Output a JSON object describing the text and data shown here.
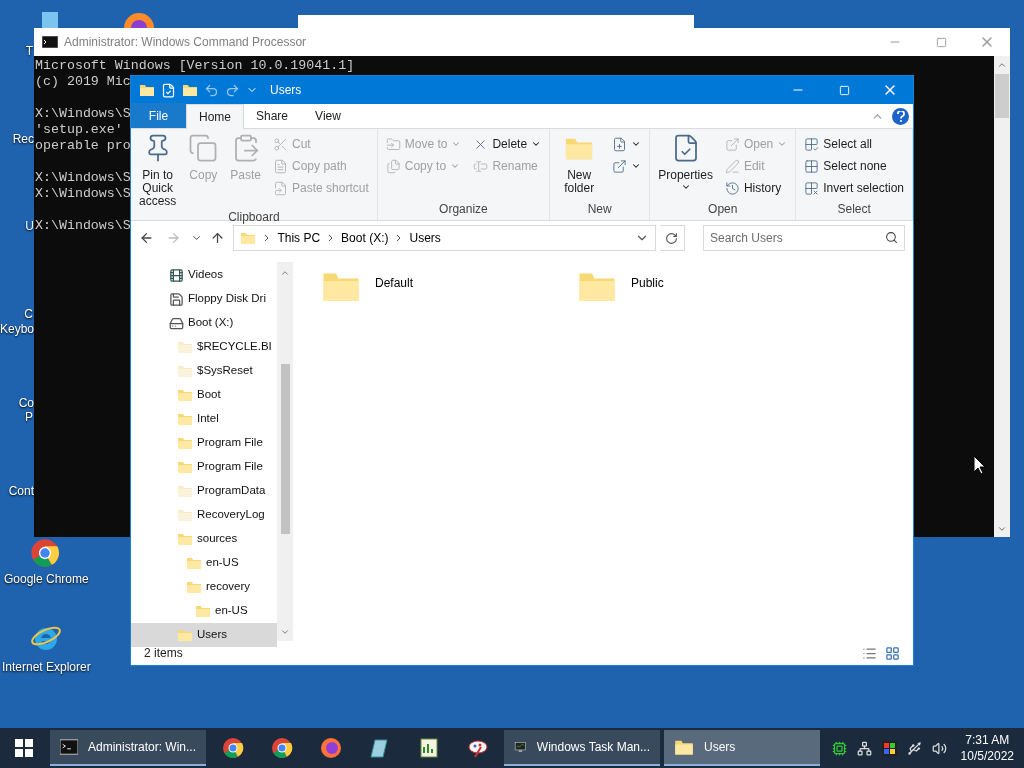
{
  "desktop": {
    "icons": [
      {
        "label": "T"
      },
      {
        "label": "Rec"
      },
      {
        "label": "U"
      },
      {
        "label": "C"
      },
      {
        "label": "Keybo"
      },
      {
        "label": "Co"
      },
      {
        "label": "P"
      },
      {
        "label": "Cont"
      },
      {
        "label": "Google Chrome"
      },
      {
        "label": "Internet Explorer"
      }
    ]
  },
  "console_window": {
    "title": "Administrator: Windows Command Processor",
    "blocks": [
      [
        "Microsoft Windows [Version 10.0.19041.1]",
        "(c) 2019 Mic"
      ],
      [
        "X:\\Windows\\S",
        "'setup.exe'",
        "operable pro"
      ],
      [
        "X:\\Windows\\S",
        "X:\\Windows\\S"
      ],
      [
        "X:\\Windows\\S"
      ]
    ]
  },
  "explorer": {
    "title": "Users",
    "tabs": [
      {
        "label": "File",
        "kind": "file"
      },
      {
        "label": "Home",
        "kind": "tab",
        "selected": true
      },
      {
        "label": "Share",
        "kind": "tab",
        "selected": false
      },
      {
        "label": "View",
        "kind": "tab",
        "selected": false
      }
    ],
    "ribbon": [
      {
        "label": "Clipboard",
        "columns": [
          {
            "kind": "large",
            "items": [
              {
                "label": "Pin to Quick access",
                "disabled": false,
                "dropdown": false
              }
            ]
          },
          {
            "kind": "large",
            "items": [
              {
                "label": "Copy",
                "disabled": true,
                "dropdown": false
              }
            ]
          },
          {
            "kind": "large",
            "items": [
              {
                "label": "Paste",
                "disabled": true,
                "dropdown": false
              }
            ]
          },
          {
            "kind": "stack",
            "items": [
              {
                "label": "Cut",
                "disabled": true,
                "dropdown": false
              },
              {
                "label": "Copy path",
                "disabled": true,
                "dropdown": false
              },
              {
                "label": "Paste shortcut",
                "disabled": true,
                "dropdown": false
              }
            ]
          }
        ]
      },
      {
        "label": "Organize",
        "columns": [
          {
            "kind": "stack",
            "items": [
              {
                "label": "Move to",
                "disabled": true,
                "dropdown": true
              },
              {
                "label": "Copy to",
                "disabled": true,
                "dropdown": true
              }
            ]
          },
          {
            "kind": "stack",
            "items": [
              {
                "label": "Delete",
                "disabled": false,
                "dropdown": true
              },
              {
                "label": "Rename",
                "disabled": true,
                "dropdown": false
              }
            ]
          }
        ]
      },
      {
        "label": "New",
        "columns": [
          {
            "kind": "large",
            "items": [
              {
                "label": "New folder",
                "disabled": false,
                "dropdown": false
              }
            ]
          },
          {
            "kind": "stack",
            "items": [
              {
                "disabled": false,
                "dropdown": true
              },
              {
                "disabled": false,
                "dropdown": true
              }
            ]
          }
        ]
      },
      {
        "label": "Open",
        "columns": [
          {
            "kind": "large",
            "items": [
              {
                "label": "Properties",
                "disabled": false,
                "dropdown": true
              }
            ]
          },
          {
            "kind": "stack",
            "items": [
              {
                "label": "Open",
                "disabled": true,
                "dropdown": true
              },
              {
                "label": "Edit",
                "disabled": true,
                "dropdown": false
              },
              {
                "label": "History",
                "disabled": false,
                "dropdown": false
              }
            ]
          }
        ]
      },
      {
        "label": "Select",
        "columns": [
          {
            "kind": "stack",
            "items": [
              {
                "label": "Select all",
                "disabled": false,
                "dropdown": false
              },
              {
                "label": "Select none",
                "disabled": false,
                "dropdown": false
              },
              {
                "label": "Invert selection",
                "disabled": false,
                "dropdown": false
              }
            ]
          }
        ]
      }
    ],
    "breadcrumbs": [
      "This PC",
      "Boot (X:)",
      "Users"
    ],
    "search": {
      "placeholder": "Search Users"
    },
    "nav_tree": [
      {
        "label": "Videos",
        "kind": "videos",
        "selected": false
      },
      {
        "label": "Floppy Disk Dri",
        "kind": "floppy",
        "selected": false
      },
      {
        "label": "Boot (X:)",
        "kind": "drive",
        "selected": false,
        "children": [
          {
            "label": "$RECYCLE.BI",
            "kind": "folder",
            "hidden": true,
            "selected": false
          },
          {
            "label": "$SysReset",
            "kind": "folder",
            "hidden": true,
            "selected": false
          },
          {
            "label": "Boot",
            "kind": "folder",
            "hidden": false,
            "selected": false
          },
          {
            "label": "Intel",
            "kind": "folder",
            "hidden": false,
            "selected": false
          },
          {
            "label": "Program File",
            "kind": "folder",
            "hidden": false,
            "selected": false
          },
          {
            "label": "Program File",
            "kind": "folder",
            "hidden": false,
            "selected": false
          },
          {
            "label": "ProgramData",
            "kind": "folder",
            "hidden": true,
            "selected": false
          },
          {
            "label": "RecoveryLog",
            "kind": "folder",
            "hidden": true,
            "selected": false
          },
          {
            "label": "sources",
            "kind": "folder",
            "hidden": false,
            "selected": false,
            "children": [
              {
                "label": "en-US",
                "kind": "folder",
                "hidden": false,
                "selected": false
              },
              {
                "label": "recovery",
                "kind": "folder",
                "hidden": false,
                "selected": false,
                "children": [
                  {
                    "label": "en-US",
                    "kind": "folder",
                    "hidden": false,
                    "selected": false
                  }
                ]
              }
            ]
          },
          {
            "label": "Users",
            "kind": "folder",
            "hidden": false,
            "selected": true
          }
        ]
      }
    ],
    "items": [
      {
        "label": "Default"
      },
      {
        "label": "Public"
      }
    ],
    "status": "2 items"
  },
  "taskbar": {
    "buttons": [
      {
        "label": "Administrator: Win...",
        "kind": "console",
        "selected": false
      },
      {
        "kind": "chrome"
      },
      {
        "kind": "chrome"
      },
      {
        "kind": "firefox"
      },
      {
        "kind": "glass"
      },
      {
        "kind": "notepad"
      },
      {
        "kind": "paint"
      },
      {
        "label": "Windows Task Man...",
        "kind": "monitor",
        "selected": false
      },
      {
        "label": "Users",
        "kind": "folder",
        "selected": true
      }
    ],
    "time": "7:31 AM",
    "date": "10/5/2022"
  }
}
